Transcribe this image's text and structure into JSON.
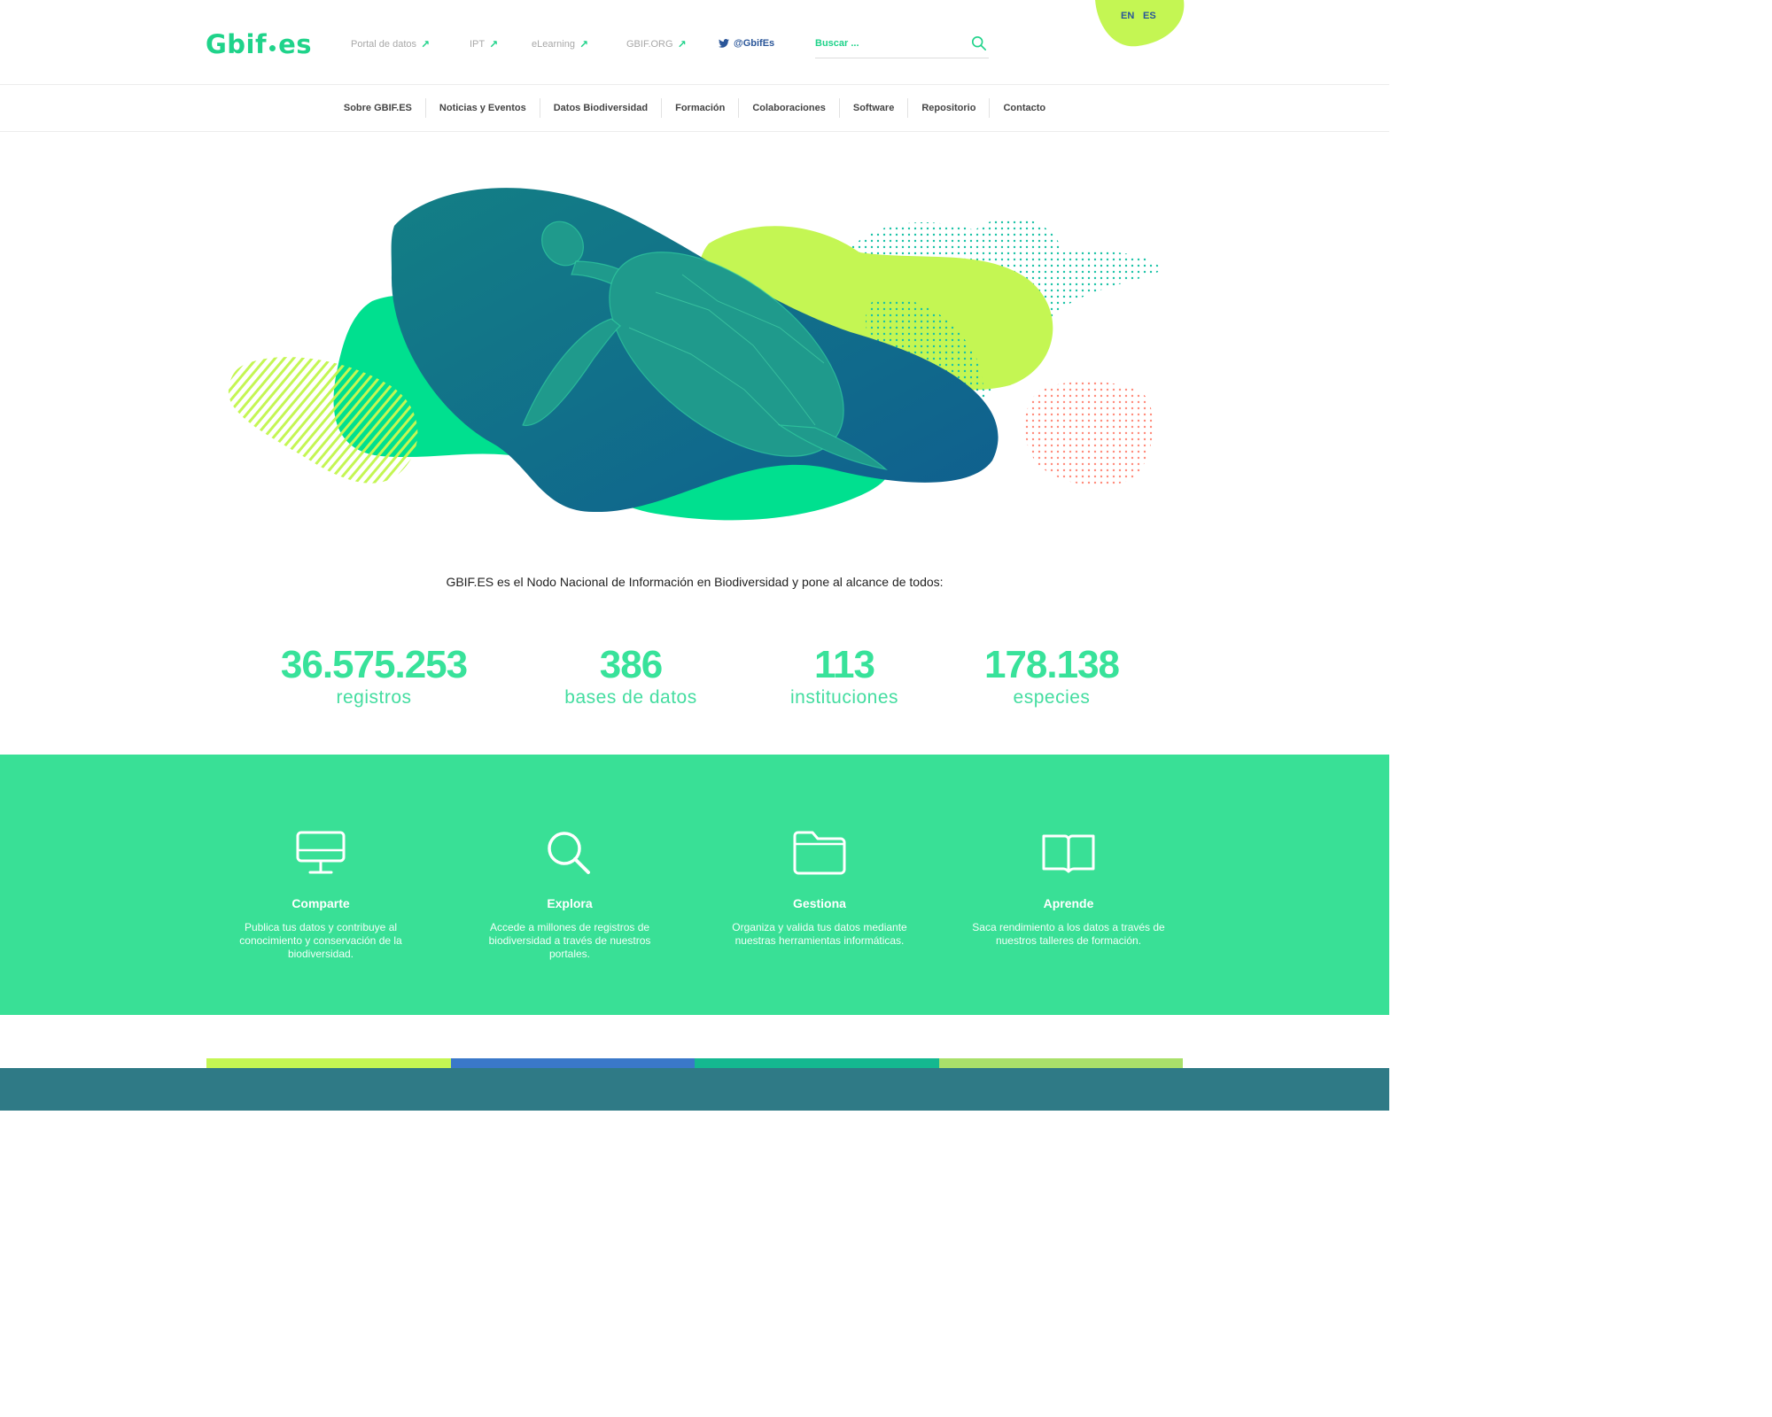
{
  "logo": {
    "left": "Gbif",
    "right": "es"
  },
  "top_links": [
    {
      "label": "Portal de datos"
    },
    {
      "label": "IPT"
    },
    {
      "label": "eLearning"
    },
    {
      "label": "GBIF.ORG"
    }
  ],
  "twitter": {
    "label": "@GbifEs",
    "icon": "twitter-bird-icon"
  },
  "search": {
    "placeholder": "Buscar ...",
    "icon": "search-icon"
  },
  "languages": [
    "EN",
    "ES"
  ],
  "nav": [
    "Sobre GBIF.ES",
    "Noticias y Eventos",
    "Datos Biodiversidad",
    "Formación",
    "Colaboraciones",
    "Software",
    "Repositorio",
    "Contacto"
  ],
  "hero": {
    "image": "sea-turtle-illustration"
  },
  "intro": "GBIF.ES es el Nodo Nacional de Información en Biodiversidad y pone al alcance de todos:",
  "stats": [
    {
      "value": "36.575.253",
      "label": "registros"
    },
    {
      "value": "386",
      "label": "bases de datos"
    },
    {
      "value": "113",
      "label": "instituciones"
    },
    {
      "value": "178.138",
      "label": "especies"
    }
  ],
  "features": [
    {
      "icon": "monitor-icon",
      "title": "Comparte",
      "description": "Publica tus datos y contribuye al conocimiento y conservación de la biodiversidad."
    },
    {
      "icon": "magnifier-icon",
      "title": "Explora",
      "description": "Accede a millones de registros de biodiversidad a través de nuestros portales."
    },
    {
      "icon": "folder-icon",
      "title": "Gestiona",
      "description": "Organiza y valida tus datos mediante nuestras herramientas informáticas."
    },
    {
      "icon": "book-icon",
      "title": "Aprende",
      "description": "Saca rendimiento a los datos a través de nuestros talleres de formación."
    }
  ],
  "colors": {
    "brand_green": "#1fd38a",
    "lime": "#c4f653",
    "band": "#39e096",
    "navy_text": "#2a5699",
    "footer": "#2f7a86",
    "bar_colors": [
      "#c4f653",
      "#3a78c9",
      "#14b890",
      "#a9e06a"
    ]
  }
}
